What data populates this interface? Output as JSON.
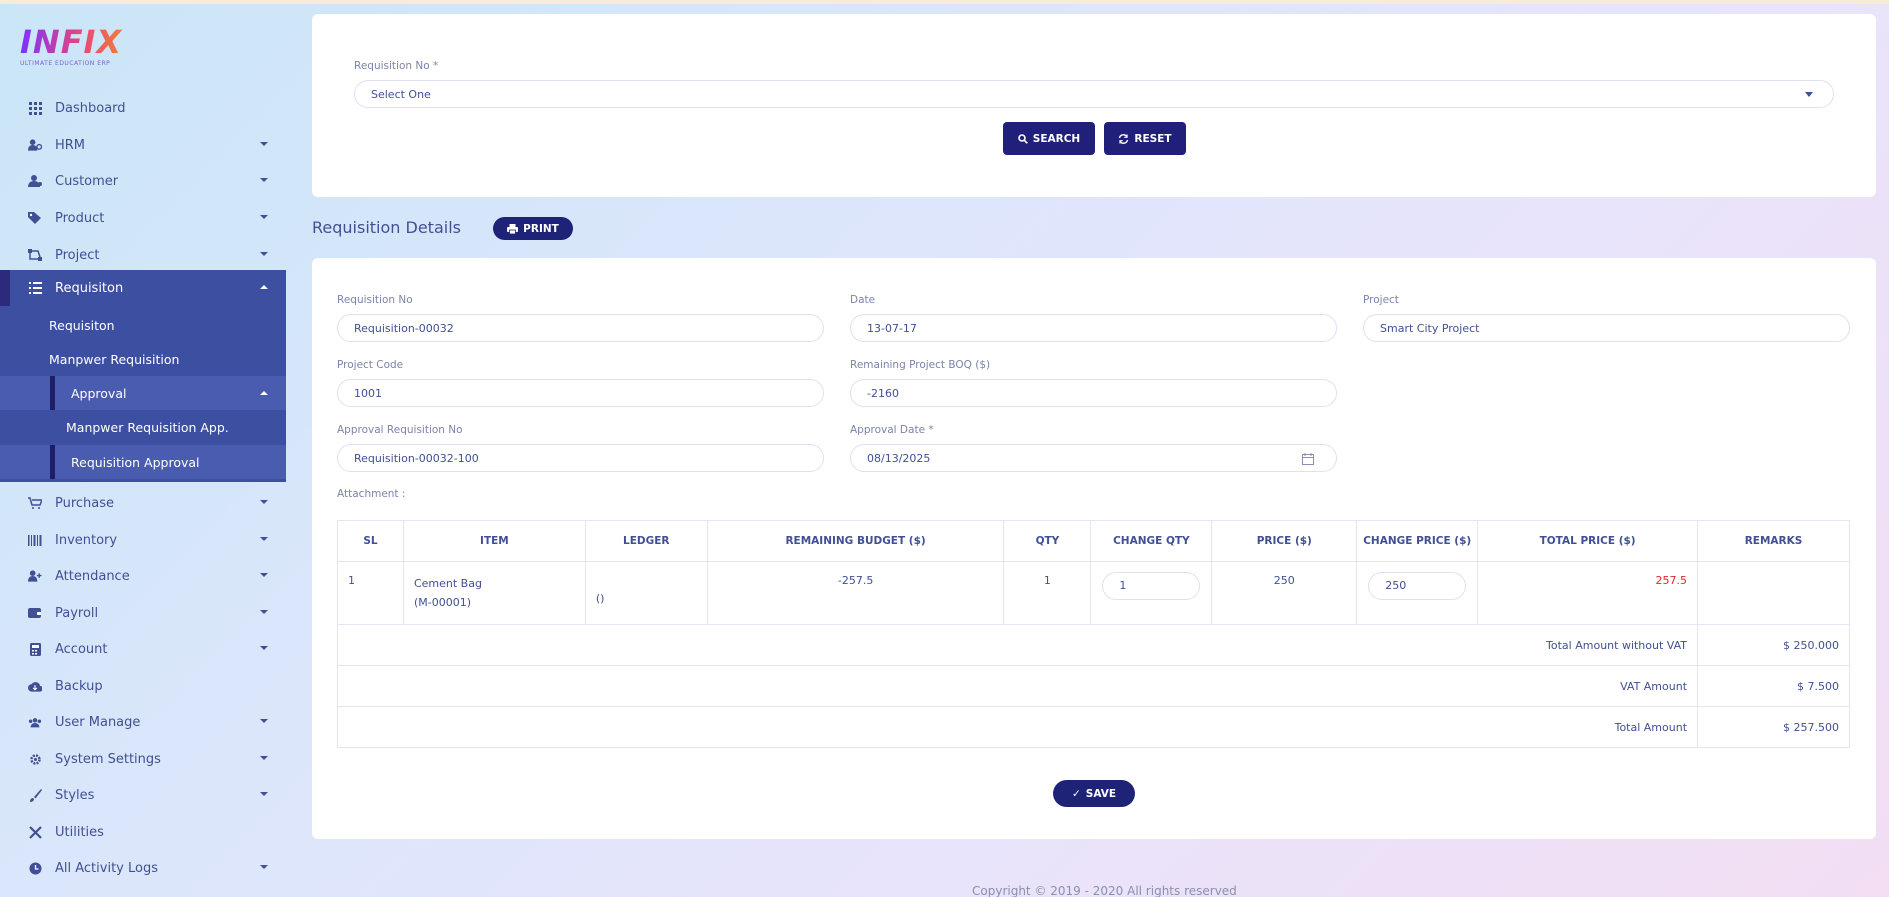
{
  "brand": {
    "logo_text": "INFIX",
    "logo_sub": "ULTIMATE EDUCATION ERP"
  },
  "sidebar": {
    "items": [
      {
        "label": "Dashboard",
        "icon": "grid-icon",
        "caret": false
      },
      {
        "label": "HRM",
        "icon": "users-cog-icon",
        "caret": true
      },
      {
        "label": "Customer",
        "icon": "user-icon",
        "caret": true
      },
      {
        "label": "Product",
        "icon": "tags-icon",
        "caret": true
      },
      {
        "label": "Project",
        "icon": "sitemap-icon",
        "caret": true
      },
      {
        "label": "Requisiton",
        "icon": "list-icon",
        "caret": true,
        "active": true
      }
    ],
    "sub_items": [
      {
        "label": "Requisiton"
      },
      {
        "label": "Manpwer Requisition"
      },
      {
        "label": "Approval"
      },
      {
        "label": "Manpwer Requisition App."
      },
      {
        "label": "Requisition Approval"
      }
    ],
    "lower_items": [
      {
        "label": "Purchase",
        "icon": "cart-icon",
        "caret": true
      },
      {
        "label": "Inventory",
        "icon": "barcode-icon",
        "caret": true
      },
      {
        "label": "Attendance",
        "icon": "user-plus-icon",
        "caret": true
      },
      {
        "label": "Payroll",
        "icon": "wallet-icon",
        "caret": true
      },
      {
        "label": "Account",
        "icon": "calculator-icon",
        "caret": true
      },
      {
        "label": "Backup",
        "icon": "cloud-icon",
        "caret": false
      },
      {
        "label": "User Manage",
        "icon": "users-icon",
        "caret": true
      },
      {
        "label": "System Settings",
        "icon": "gear-icon",
        "caret": true
      },
      {
        "label": "Styles",
        "icon": "brush-icon",
        "caret": true
      },
      {
        "label": "Utilities",
        "icon": "tools-icon",
        "caret": false
      },
      {
        "label": "All Activity Logs",
        "icon": "clock-icon",
        "caret": true
      }
    ]
  },
  "search_panel": {
    "requisition_label": "Requisition No *",
    "requisition_select": "Select One",
    "search_label": "SEARCH",
    "reset_label": "RESET"
  },
  "details": {
    "title": "Requisition Details",
    "print_label": "PRINT",
    "fields": {
      "req_no_label": "Requisition No",
      "req_no_value": "Requisition-00032",
      "date_label": "Date",
      "date_value": "13-07-17",
      "project_label": "Project",
      "project_value": "Smart City Project",
      "code_label": "Project Code",
      "code_value": "1001",
      "boq_label": "Remaining Project BOQ ($)",
      "boq_value": "-2160",
      "appr_no_label": "Approval Requisition No",
      "appr_no_value": "Requisition-00032-100",
      "appr_date_label": "Approval Date *",
      "appr_date_value": "08/13/2025",
      "attachment_label": "Attachment :"
    },
    "table": {
      "headers": [
        "SL",
        "ITEM",
        "LEDGER",
        "REMAINING BUDGET ($)",
        "QTY",
        "CHANGE QTY",
        "PRICE ($)",
        "CHANGE PRICE ($)",
        "TOTAL PRICE ($)",
        "REMARKS"
      ],
      "row": {
        "sl": "1",
        "item_line1": "Cement Bag",
        "item_line2": "(M-00001)",
        "ledger": "()",
        "remaining": "-257.5",
        "qty": "1",
        "change_qty": "1",
        "price": "250",
        "change_price": "250",
        "total": "257.5",
        "remarks": ""
      },
      "totals": [
        {
          "label": "Total Amount without VAT",
          "value": "$ 250.000"
        },
        {
          "label": "VAT Amount",
          "value": "$ 7.500"
        },
        {
          "label": "Total Amount",
          "value": "$ 257.500"
        }
      ]
    },
    "save_label": "SAVE"
  },
  "footer": {
    "text": "Copyright © 2019 - 2020 All rights reserved"
  },
  "colors": {
    "primary": "#20207a",
    "accent_active": "#3d4fa0",
    "text": "#415094",
    "danger": "#e3262b"
  }
}
